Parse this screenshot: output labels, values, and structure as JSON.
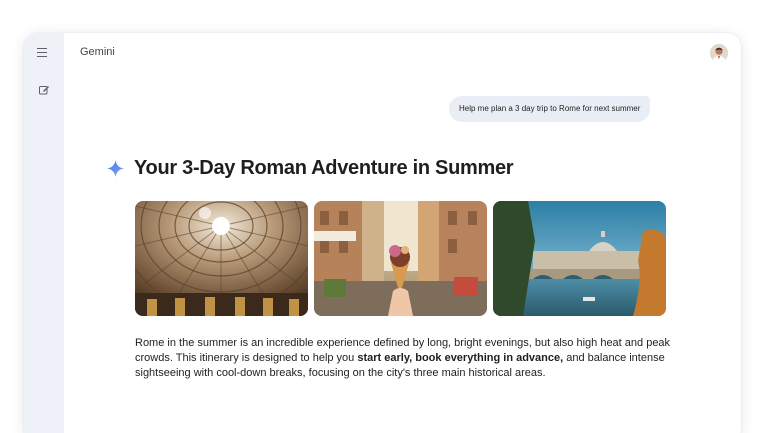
{
  "app": {
    "title": "Gemini"
  },
  "sidebar": {
    "menu_icon": "hamburger-menu-icon",
    "new_chat_icon": "edit-icon"
  },
  "header": {
    "avatar_icon": "user-avatar"
  },
  "conversation": {
    "user_message": "Help me plan a 3 day trip to Rome for next summer",
    "response": {
      "icon": "gemini-sparkle-icon",
      "title": "Your 3-Day Roman Adventure in Summer",
      "images": [
        {
          "subject": "Pantheon dome interior"
        },
        {
          "subject": "Gelato cone on a Roman street"
        },
        {
          "subject": "Tiber river with St. Peter's Basilica"
        }
      ],
      "paragraph": {
        "part1": "Rome in the summer is an incredible experience defined by long, bright evenings, but also high heat and peak crowds. This itinerary is designed to help you ",
        "bold": "start early, book everything in advance,",
        "part2": " and balance intense sightseeing with cool-down breaks, focusing on the city's three main historical areas."
      }
    }
  },
  "colors": {
    "rail_bg": "#eef1f8",
    "bubble_bg": "#e9eef6",
    "spark_blue": "#4b7be5",
    "text": "#1f1f1f"
  }
}
